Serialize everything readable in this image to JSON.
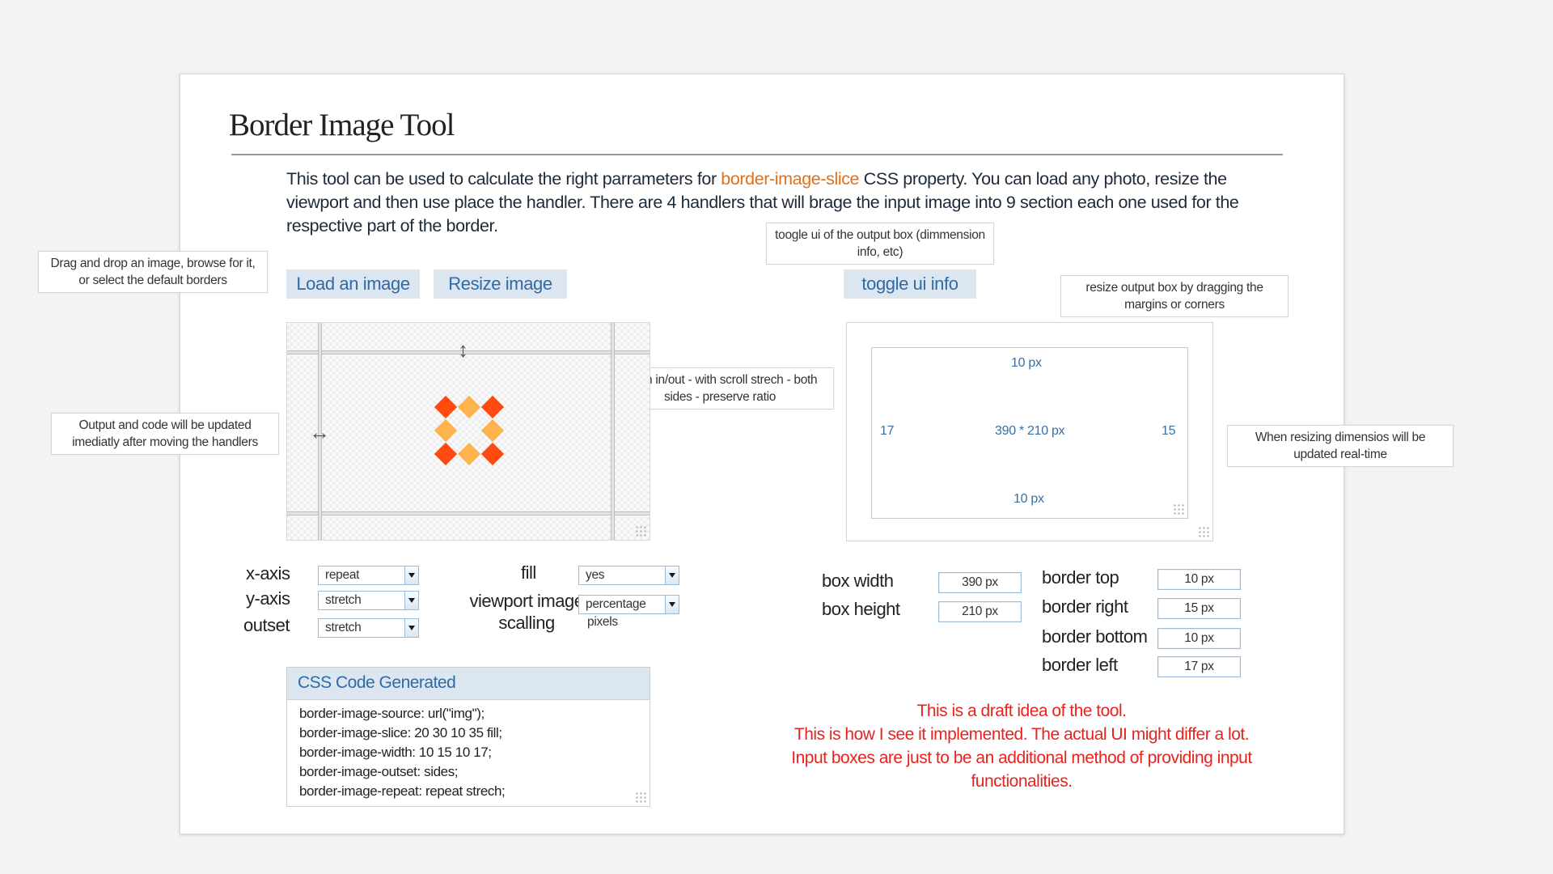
{
  "page": {
    "title": "Border Image Tool",
    "intro_before": "This tool can be used to calculate the right parrameters for ",
    "intro_highlight": "border-image-slice",
    "intro_after": " CSS property. You can load any photo, resize the viewport and then use place the handler. There are 4 handlers that will brage the input image into 9 section each one used for the respective part of the border."
  },
  "notes": {
    "drag_drop": "Drag and drop an image, browse for it, or select the default borders",
    "output_updated": "Output and code will be updated imediatly after moving the handlers",
    "zoom": "zoom in/out - with scroll strech - both sides -  preserve ratio",
    "toggle_ui": "toogle ui  of the output box (dimmension info, etc)",
    "resize_output": "resize output box by dragging the margins or corners",
    "when_resizing": "When resizing dimensios will be updated real-time"
  },
  "buttons": {
    "load_image": "Load an image",
    "resize_image": "Resize image",
    "toggle_ui_info": "toggle ui info"
  },
  "output_box": {
    "top": "10 px",
    "bottom": "10 px",
    "left": "17",
    "right": "15",
    "center": "390 * 210 px"
  },
  "controls": {
    "x_axis_label": "x-axis",
    "x_axis_value": "repeat",
    "y_axis_label": "y-axis",
    "y_axis_value": "stretch",
    "outset_label": "outset",
    "outset_value": "stretch",
    "fill_label": "fill",
    "fill_value": "yes",
    "viewport_label_1": "viewport image",
    "viewport_label_2": "scalling",
    "viewport_value": "percentage",
    "viewport_option_2": "pixels"
  },
  "dimensions": {
    "box_width_label": "box width",
    "box_width_value": "390 px",
    "box_height_label": "box height",
    "box_height_value": "210 px",
    "border_top_label": "border top",
    "border_top_value": "10 px",
    "border_right_label": "border right",
    "border_right_value": "15 px",
    "border_bottom_label": "border bottom",
    "border_bottom_value": "10 px",
    "border_left_label": "border left",
    "border_left_value": "17 px"
  },
  "code": {
    "header": "CSS Code Generated",
    "lines": [
      "border-image-source: url(\"img\");",
      "border-image-slice: 20 30 10 35 fill;",
      "border-image-width: 10 15 10 17;",
      "border-image-outset:  sides;",
      "border-image-repeat: repeat strech;"
    ]
  },
  "draft_note": {
    "line1": "This is a draft idea of the tool.",
    "line2": "This is how I see it implemented. The actual UI might differ a lot.",
    "line3": "Input boxes are just to be an additional method of providing input functionalities."
  },
  "colors": {
    "accent_blue": "#2f6aa7",
    "button_bg": "#dce6f0",
    "highlight_orange": "#e0701a",
    "draft_red": "#e8231f",
    "diamond_red": "#ff4a10",
    "diamond_orange": "#ffb34d"
  }
}
